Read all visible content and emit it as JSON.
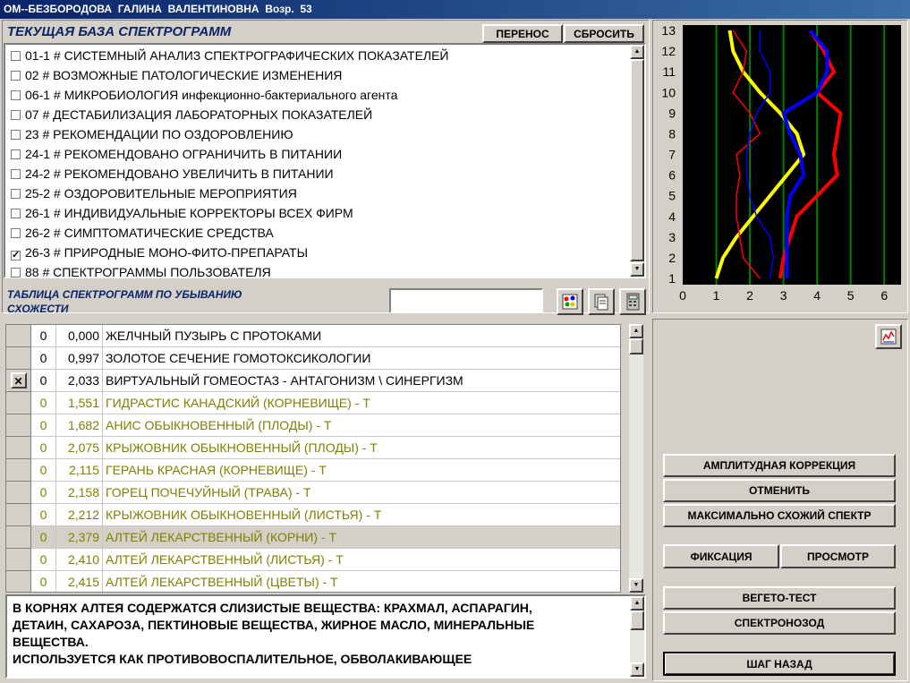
{
  "window": {
    "title": "ОМ--БЕЗБОРОДОВА  ГАЛИНА  ВАЛЕНТИНОВНА  Возр.  53"
  },
  "base": {
    "title": "ТЕКУЩАЯ БАЗА СПЕКТРОГРАММ",
    "transfer_label": "ПЕРЕНОС",
    "reset_label": "СБРОСИТЬ",
    "items": [
      {
        "label": "01-1 # СИСТЕМНЫЙ АНАЛИЗ СПЕКТРОГРАФИЧЕСКИХ ПОКАЗАТЕЛЕЙ",
        "checked": false
      },
      {
        "label": "02 # ВОЗМОЖНЫЕ ПАТОЛОГИЧЕСКИЕ ИЗМЕНЕНИЯ",
        "checked": false
      },
      {
        "label": "06-1 # МИКРОБИОЛОГИЯ инфекционно-бактериального агента",
        "checked": false
      },
      {
        "label": "07 # ДЕСТАБИЛИЗАЦИЯ ЛАБОРАТОРНЫХ ПОКАЗАТЕЛЕЙ",
        "checked": false
      },
      {
        "label": "23 # РЕКОМЕНДАЦИИ ПО ОЗДОРОВЛЕНИЮ",
        "checked": false
      },
      {
        "label": "24-1 # РЕКОМЕНДОВАНО ОГРАНИЧИТЬ В ПИТАНИИ",
        "checked": false
      },
      {
        "label": "24-2 # РЕКОМЕНДОВАНО УВЕЛИЧИТЬ В ПИТАНИИ",
        "checked": false
      },
      {
        "label": "25-2 #  ОЗДОРОВИТЕЛЬНЫЕ МЕРОПРИЯТИЯ",
        "checked": false
      },
      {
        "label": "26-1 #  ИНДИВИДУАЛЬНЫЕ КОРРЕКТОРЫ  ВСЕХ  ФИРМ",
        "checked": false
      },
      {
        "label": "26-2 #  СИМПТОМАТИЧЕСКИЕ  СРЕДСТВА",
        "checked": false
      },
      {
        "label": "26-3 #  ПРИРОДНЫЕ МОНО-ФИТО-ПРЕПАРАТЫ",
        "checked": true
      },
      {
        "label": "88 #  СПЕКТРОГРАММЫ ПОЛЬЗОВАТЕЛЯ",
        "checked": false
      }
    ]
  },
  "table": {
    "title_line1": "ТАБЛИЦА СПЕКТРОГРАММ ПО УБЫВАНИЮ",
    "title_line2": "СХОЖЕСТИ",
    "search_value": "",
    "check_mark": "✓",
    "rows": [
      {
        "marker": "",
        "flag": "0",
        "value": "0,000",
        "name": "ЖЕЛЧНЫЙ  ПУЗЫРЬ С ПРОТОКАМИ",
        "style": "normal"
      },
      {
        "marker": "",
        "flag": "0",
        "value": "0,997",
        "name": "ЗОЛОТОЕ СЕЧЕНИЕ ГОМОТОКСИКОЛОГИИ",
        "style": "normal"
      },
      {
        "marker": "✕",
        "flag": "0",
        "value": "2,033",
        "name": "ВИРТУАЛЬНЫЙ ГОМЕОСТАЗ - АНТАГОНИЗМ \\ СИНЕРГИЗМ",
        "style": "normal"
      },
      {
        "marker": "",
        "flag": "0",
        "value": "1,551",
        "name": "ГИДРАСТИС  КАНАДСКИЙ  (КОРНЕВИЩЕ)  - Т",
        "style": "olive"
      },
      {
        "marker": "",
        "flag": "0",
        "value": "1,682",
        "name": "АНИС ОБЫКНОВЕННЫЙ (ПЛОДЫ) - Т",
        "style": "olive"
      },
      {
        "marker": "",
        "flag": "0",
        "value": "2,075",
        "name": "КРЫЖОВНИК ОБЫКНОВЕННЫЙ (ПЛОДЫ) - Т",
        "style": "olive"
      },
      {
        "marker": "",
        "flag": "0",
        "value": "2,115",
        "name": "ГЕРАНЬ КРАСНАЯ (КОРНЕВИЩЕ) - Т",
        "style": "olive"
      },
      {
        "marker": "",
        "flag": "0",
        "value": "2,158",
        "name": "ГОРЕЦ ПОЧЕЧУЙНЫЙ (ТРАВА) - Т",
        "style": "olive"
      },
      {
        "marker": "",
        "flag": "0",
        "value": "2,212",
        "name": "КРЫЖОВНИК ОБЫКНОВЕННЫЙ (ЛИСТЬЯ) - Т",
        "style": "olive"
      },
      {
        "marker": "",
        "flag": "0",
        "value": "2,379",
        "name": "АЛТЕЙ ЛЕКАРСТВЕННЫЙ (КОРНИ) - Т",
        "style": "selected"
      },
      {
        "marker": "",
        "flag": "0",
        "value": "2,410",
        "name": "АЛТЕЙ ЛЕКАРСТВЕННЫЙ (ЛИСТЬЯ) - Т",
        "style": "olive"
      },
      {
        "marker": "",
        "flag": "0",
        "value": "2,415",
        "name": "АЛТЕЙ ЛЕКАРСТВЕННЫЙ (ЦВЕТЫ) - Т",
        "style": "olive"
      }
    ]
  },
  "info": {
    "line1": "В КОРНЯХ АЛТЕЯ СОДЕРЖАТСЯ СЛИЗИСТЫЕ ВЕЩЕСТВА: КРАХМАЛ,  АСПАРАГИН,",
    "line2": "ДЕТАИН,  САХАРОЗА,  ПЕКТИНОВЫЕ ВЕЩЕСТВА,  ЖИРНОЕ МАСЛО, МИНЕРАЛЬНЫЕ",
    "line3": "ВЕЩЕСТВА.",
    "line4": "ИСПОЛЬЗУЕТСЯ КАК ПРОТИВОВОСПАЛИТЕЛЬНОЕ,  ОБВОЛАКИВАЮЩЕЕ"
  },
  "buttons": {
    "amplitude": "АМПЛИТУДНАЯ КОРРЕКЦИЯ",
    "cancel": "ОТМЕНИТЬ",
    "max_similar": "МАКСИМАЛЬНО СХОЖИЙ СПЕКТР",
    "fix": "ФИКСАЦИЯ",
    "view": "ПРОСМОТР",
    "vegeto": "ВЕГЕТО-ТЕСТ",
    "spectronosode": "СПЕКТРОНОЗОД",
    "step_back": "ШАГ НАЗАД"
  },
  "colors": {
    "plot_bg": "#000000",
    "grid": "#008000",
    "yellow": "#ffff00",
    "red": "#ff0000",
    "blue": "#0000ff",
    "olive_text": "#808000",
    "selected_bg": "#d4d0c8"
  },
  "chart_data": {
    "type": "line",
    "xlim": [
      0,
      6.5
    ],
    "ylim": [
      1,
      13
    ],
    "x_ticks": [
      "0",
      "1",
      "2",
      "3",
      "4",
      "5",
      "6"
    ],
    "y_ticks": [
      "1",
      "2",
      "3",
      "4",
      "5",
      "6",
      "7",
      "8",
      "9",
      "10",
      "11",
      "12",
      "13"
    ],
    "grid": "vertical",
    "series": [
      {
        "color": "yellow",
        "width": 4,
        "points": [
          [
            1.0,
            1
          ],
          [
            1.2,
            2
          ],
          [
            1.6,
            3
          ],
          [
            2.1,
            4
          ],
          [
            2.6,
            5
          ],
          [
            3.1,
            6
          ],
          [
            3.6,
            7
          ],
          [
            3.4,
            8
          ],
          [
            2.9,
            9
          ],
          [
            2.3,
            10
          ],
          [
            1.8,
            11
          ],
          [
            1.5,
            12
          ],
          [
            1.4,
            13
          ]
        ]
      },
      {
        "color": "red",
        "width": 4,
        "points": [
          [
            2.9,
            1
          ],
          [
            3.0,
            2
          ],
          [
            3.2,
            3
          ],
          [
            3.4,
            4
          ],
          [
            4.0,
            5
          ],
          [
            4.6,
            6
          ],
          [
            4.5,
            7
          ],
          [
            4.6,
            8
          ],
          [
            4.7,
            9
          ],
          [
            4.0,
            10
          ],
          [
            4.5,
            11
          ],
          [
            4.2,
            12
          ],
          [
            3.8,
            13
          ]
        ]
      },
      {
        "color": "blue",
        "width": 4,
        "points": [
          [
            3.1,
            1
          ],
          [
            3.1,
            2
          ],
          [
            3.1,
            3
          ],
          [
            3.1,
            4
          ],
          [
            3.2,
            5
          ],
          [
            3.6,
            6
          ],
          [
            3.5,
            7
          ],
          [
            3.2,
            8
          ],
          [
            3.0,
            9
          ],
          [
            4.0,
            10
          ],
          [
            4.3,
            11
          ],
          [
            4.3,
            12
          ],
          [
            3.8,
            13
          ]
        ]
      },
      {
        "color": "red",
        "width": 1.5,
        "points": [
          [
            2.3,
            1
          ],
          [
            1.8,
            2
          ],
          [
            1.7,
            3
          ],
          [
            1.6,
            4
          ],
          [
            1.6,
            5
          ],
          [
            1.7,
            6
          ],
          [
            1.6,
            7
          ],
          [
            2.3,
            8
          ],
          [
            2.0,
            9
          ],
          [
            1.5,
            10
          ],
          [
            1.8,
            11
          ],
          [
            1.9,
            12
          ],
          [
            1.5,
            13
          ]
        ]
      },
      {
        "color": "blue",
        "width": 1.5,
        "points": [
          [
            2.6,
            1
          ],
          [
            2.7,
            2
          ],
          [
            2.6,
            3
          ],
          [
            2.2,
            4
          ],
          [
            2.0,
            5
          ],
          [
            1.9,
            6
          ],
          [
            1.9,
            7
          ],
          [
            2.0,
            8
          ],
          [
            2.2,
            9
          ],
          [
            2.6,
            10
          ],
          [
            2.6,
            11
          ],
          [
            2.3,
            12
          ],
          [
            2.3,
            13
          ]
        ]
      }
    ]
  }
}
